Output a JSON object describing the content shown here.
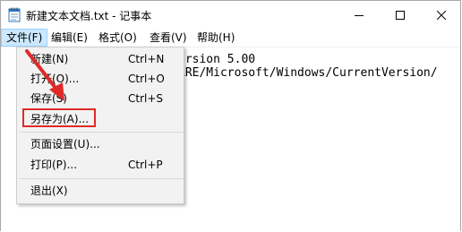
{
  "window": {
    "title": "新建文本文档.txt - 记事本",
    "controls": {
      "minimize_icon": "minimize-icon",
      "maximize_icon": "maximize-icon",
      "close_icon": "close-icon"
    }
  },
  "menubar": {
    "items": [
      {
        "label": "文件(F)"
      },
      {
        "label": "编辑(E)"
      },
      {
        "label": "格式(O)"
      },
      {
        "label": "查看(V)"
      },
      {
        "label": "帮助(H)"
      }
    ]
  },
  "editor": {
    "lines": [
      "ersion 5.00",
      "ARE/Microsoft/Windows/CurrentVersion/"
    ]
  },
  "file_menu": {
    "items": [
      {
        "label": "新建(N)",
        "shortcut": "Ctrl+N"
      },
      {
        "label": "打开(O)...",
        "shortcut": "Ctrl+O"
      },
      {
        "label": "保存(S)",
        "shortcut": "Ctrl+S"
      },
      {
        "label": "另存为(A)...",
        "shortcut": ""
      },
      {
        "label": "页面设置(U)...",
        "shortcut": ""
      },
      {
        "label": "打印(P)...",
        "shortcut": "Ctrl+P"
      },
      {
        "label": "退出(X)",
        "shortcut": ""
      }
    ]
  },
  "annotation": {
    "highlight_color": "#e02a2a",
    "active_menu_color": "#cce8ff"
  }
}
